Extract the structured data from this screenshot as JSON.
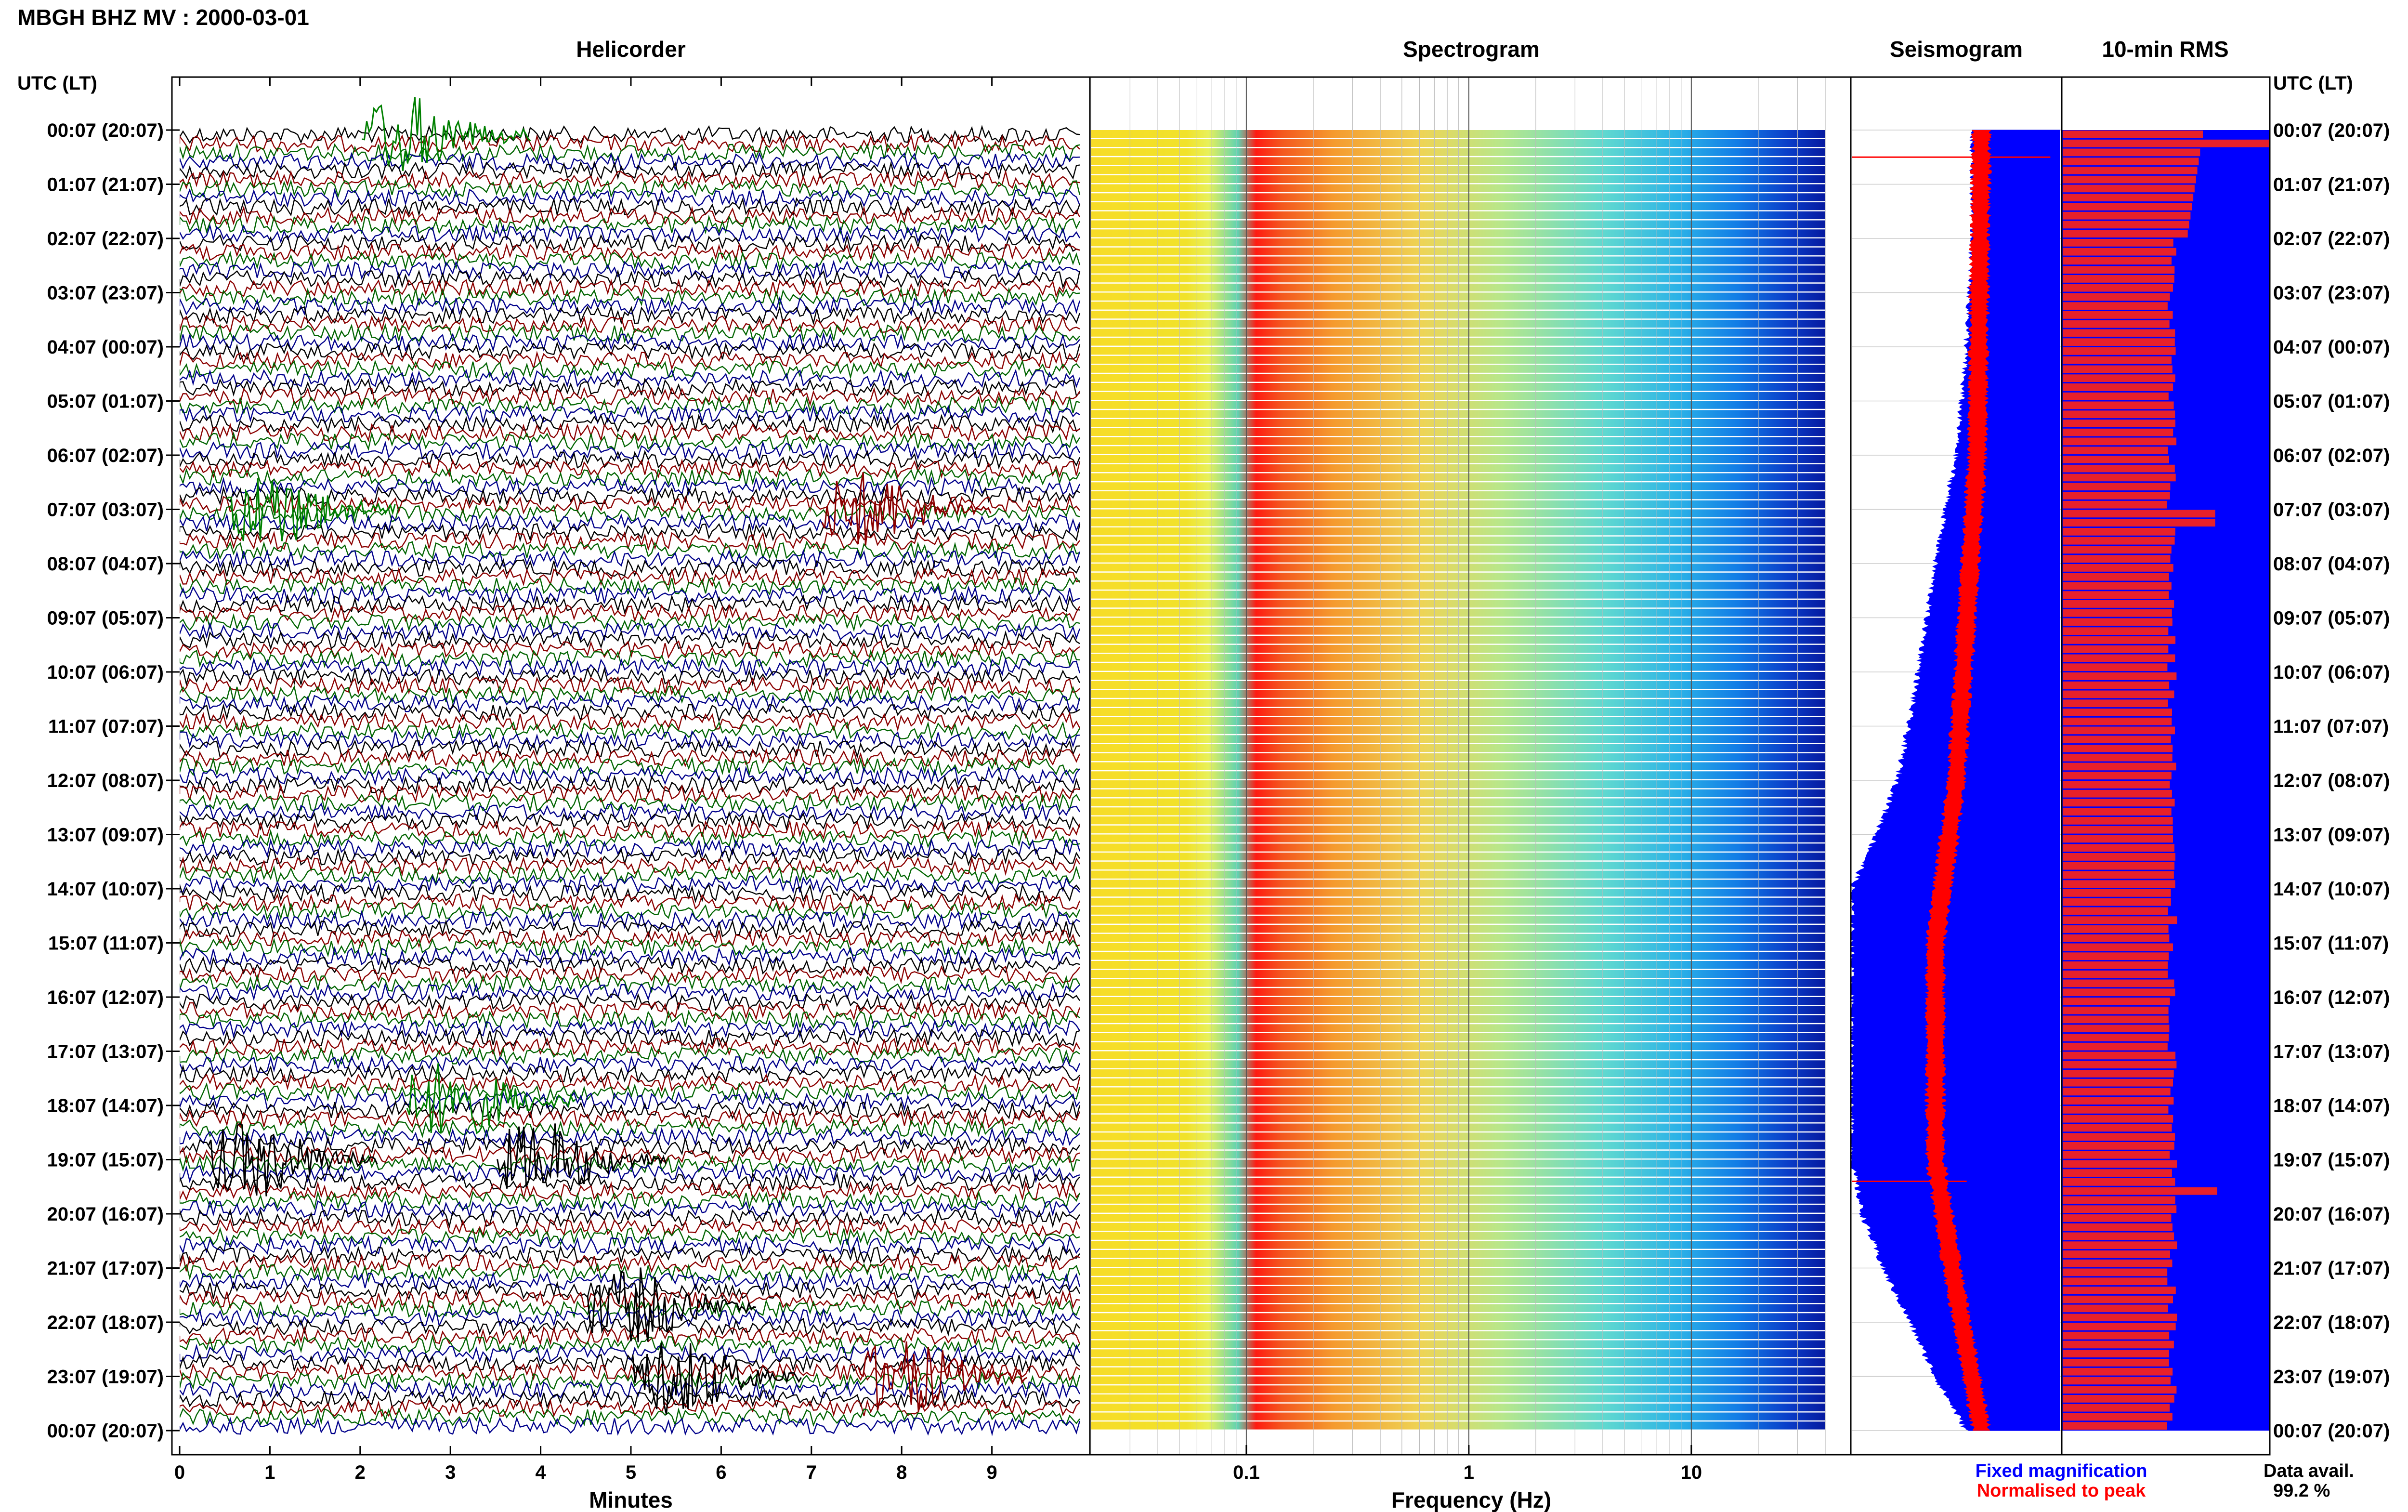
{
  "header": {
    "station_title": "MBGH BHZ MV : 2000-03-01"
  },
  "panels": {
    "helicorder": "Helicorder",
    "spectrogram": "Spectrogram",
    "seismogram": "Seismogram",
    "rms": "10-min RMS"
  },
  "axis": {
    "time_label_left": "UTC (LT)",
    "time_label_right": "UTC (LT)",
    "minutes_label": "Minutes",
    "frequency_label": "Frequency (Hz)"
  },
  "legend": {
    "fixed_magnification": "Fixed magnification",
    "normalised_to_peak": "Normalised to peak",
    "fixed_color": "#0000ff",
    "normalised_color": "#ff0000"
  },
  "data_availability": {
    "label": "Data avail.",
    "value": "99.2 %"
  },
  "colors": {
    "trace_cycle": [
      "#000000",
      "#8b0000",
      "#006400",
      "#00008b"
    ],
    "seismogram_fixed": "#0000ff",
    "seismogram_normalised": "#ff0000",
    "rms_bar": "#e8202a",
    "rms_background": "#0000ff"
  },
  "chart_data": [
    {
      "type": "line",
      "panel": "helicorder",
      "x_ticks": [
        "0",
        "1",
        "2",
        "3",
        "4",
        "5",
        "6",
        "7",
        "8",
        "9"
      ],
      "xlim": [
        0,
        10
      ],
      "xlabel": "Minutes",
      "row_labels": [
        "00:07 (20:07)",
        "01:07 (21:07)",
        "02:07 (22:07)",
        "03:07 (23:07)",
        "04:07 (00:07)",
        "05:07 (01:07)",
        "06:07 (02:07)",
        "07:07 (03:07)",
        "08:07 (04:07)",
        "09:07 (05:07)",
        "10:07 (06:07)",
        "11:07 (07:07)",
        "12:07 (08:07)",
        "13:07 (09:07)",
        "14:07 (10:07)",
        "15:07 (11:07)",
        "16:07 (12:07)",
        "17:07 (13:07)",
        "18:07 (14:07)",
        "19:07 (15:07)",
        "20:07 (16:07)",
        "21:07 (17:07)",
        "22:07 (18:07)",
        "23:07 (19:07)",
        "00:07 (20:07)"
      ],
      "traces_per_hour": 6,
      "events": [
        {
          "hour": 0.1,
          "minute": 2.5,
          "color": "green"
        },
        {
          "hour": 7.0,
          "minute": 1.0,
          "color": "green"
        },
        {
          "hour": 7.0,
          "minute": 7.6,
          "color": "darkred"
        },
        {
          "hour": 17.9,
          "minute": 3.0,
          "color": "green"
        },
        {
          "hour": 19.0,
          "minute": 0.8,
          "color": "black"
        },
        {
          "hour": 19.0,
          "minute": 4.0,
          "color": "black"
        },
        {
          "hour": 21.7,
          "minute": 5.0,
          "color": "black"
        },
        {
          "hour": 23.0,
          "minute": 5.5,
          "color": "black"
        },
        {
          "hour": 23.0,
          "minute": 8.0,
          "color": "darkred"
        }
      ]
    },
    {
      "type": "heatmap",
      "panel": "spectrogram",
      "x_scale": "log",
      "xlim": [
        0.02,
        40
      ],
      "x_ticks": [
        "0.1",
        "1",
        "10"
      ],
      "xlabel": "Frequency (Hz)",
      "rows": 144,
      "microseism_peak_hz": [
        0.14,
        0.22
      ]
    },
    {
      "type": "line",
      "panel": "seismogram",
      "series": [
        {
          "name": "Fixed magnification",
          "envelope_hours": [
            0,
            2,
            4,
            6,
            8,
            10,
            12,
            13,
            14,
            15,
            16,
            17,
            18,
            19,
            20,
            21,
            22,
            23,
            24
          ],
          "width_relative": [
            0.42,
            0.42,
            0.45,
            0.5,
            0.6,
            0.68,
            0.78,
            0.88,
            1.0,
            1.0,
            1.0,
            1.0,
            1.0,
            1.0,
            0.95,
            0.85,
            0.72,
            0.6,
            0.45
          ]
        },
        {
          "name": "Normalised to peak",
          "envelope_hours": [
            0,
            6,
            12,
            15,
            19,
            21,
            24
          ],
          "offset_relative": [
            0.62,
            0.6,
            0.5,
            0.4,
            0.4,
            0.48,
            0.62
          ]
        }
      ]
    },
    {
      "type": "bar",
      "panel": "rms",
      "orientation": "horizontal",
      "bars": 144,
      "typical_relative_value": 0.53,
      "peaks": [
        {
          "hour": 0.1,
          "value": 1.0
        },
        {
          "hour": 7.1,
          "value": 0.74
        },
        {
          "hour": 19.5,
          "value": 0.75
        }
      ]
    }
  ]
}
